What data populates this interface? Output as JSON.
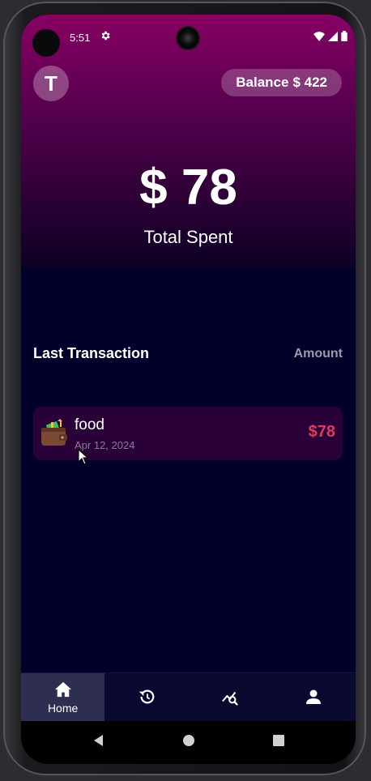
{
  "status_bar": {
    "time": "5:51"
  },
  "header": {
    "avatar_letter": "T",
    "balance_label": "Balance",
    "balance_value": "$ 422"
  },
  "summary": {
    "total_amount": "$ 78",
    "total_label": "Total Spent"
  },
  "transactions_section": {
    "title": "Last Transaction",
    "amount_header": "Amount",
    "items": [
      {
        "icon": "wallet-icon",
        "name": "food",
        "date": "Apr 12, 2024",
        "amount": "$78"
      }
    ]
  },
  "bottom_nav": {
    "items": [
      {
        "icon": "home-icon",
        "label": "Home",
        "active": true
      },
      {
        "icon": "history-icon",
        "label": "",
        "active": false
      },
      {
        "icon": "analytics-icon",
        "label": "",
        "active": false
      },
      {
        "icon": "profile-icon",
        "label": "",
        "active": false
      }
    ]
  },
  "colors": {
    "header_top": "#870063",
    "background": "#00002b",
    "card": "#2a0038",
    "amount_red": "#e03a5a"
  }
}
